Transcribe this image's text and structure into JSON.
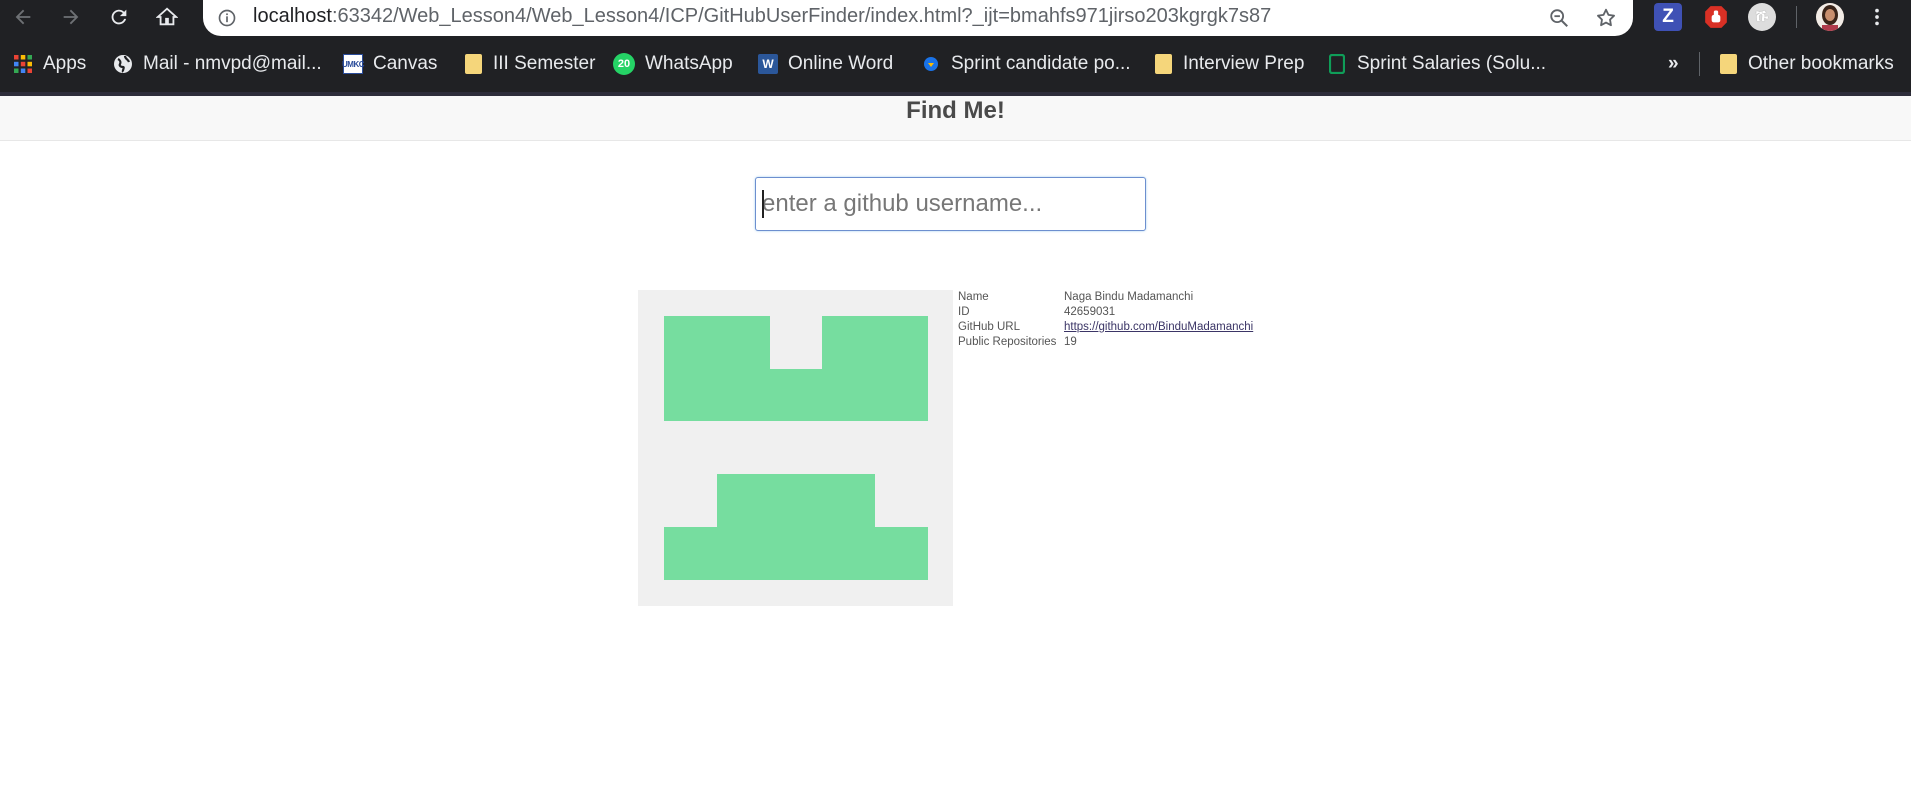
{
  "browser": {
    "url_host": "localhost",
    "url_rest": ":63342/Web_Lesson4/Web_Lesson4/ICP/GitHubUserFinder/index.html?_ijt=bmahfs971jirso203kgrgk7s87",
    "extensions": [
      "Z",
      "stop-sign",
      "user-extension"
    ],
    "accent": "#202124"
  },
  "bookmarks": [
    {
      "label": "Apps",
      "icon": "apps-grid-icon"
    },
    {
      "label": "Mail - nmvpd@mail...",
      "icon": "globe-icon"
    },
    {
      "label": "Canvas",
      "icon": "umkc-icon"
    },
    {
      "label": "III Semester",
      "icon": "folder-icon"
    },
    {
      "label": "WhatsApp",
      "icon": "whatsapp-icon",
      "badge": "20"
    },
    {
      "label": "Online Word",
      "icon": "word-icon"
    },
    {
      "label": "Sprint candidate po...",
      "icon": "sprint-icon"
    },
    {
      "label": "Interview Prep",
      "icon": "folder-icon"
    },
    {
      "label": "Sprint Salaries (Solu...",
      "icon": "sheets-icon"
    },
    {
      "label": "»",
      "icon": "overflow-chevron-icon"
    },
    {
      "label": "Other bookmarks",
      "icon": "folder-icon"
    }
  ],
  "page": {
    "title": "Find Me!",
    "search_placeholder": "enter a github username...",
    "avatar_color": "#76dd9f",
    "profile": {
      "rows": [
        {
          "label": "Name",
          "value": "Naga Bindu Madamanchi"
        },
        {
          "label": "ID",
          "value": "42659031"
        },
        {
          "label": "GitHub URL",
          "value": "https://github.com/BinduMadamanchi"
        },
        {
          "label": "Public Repositories",
          "value": "19"
        }
      ]
    }
  }
}
